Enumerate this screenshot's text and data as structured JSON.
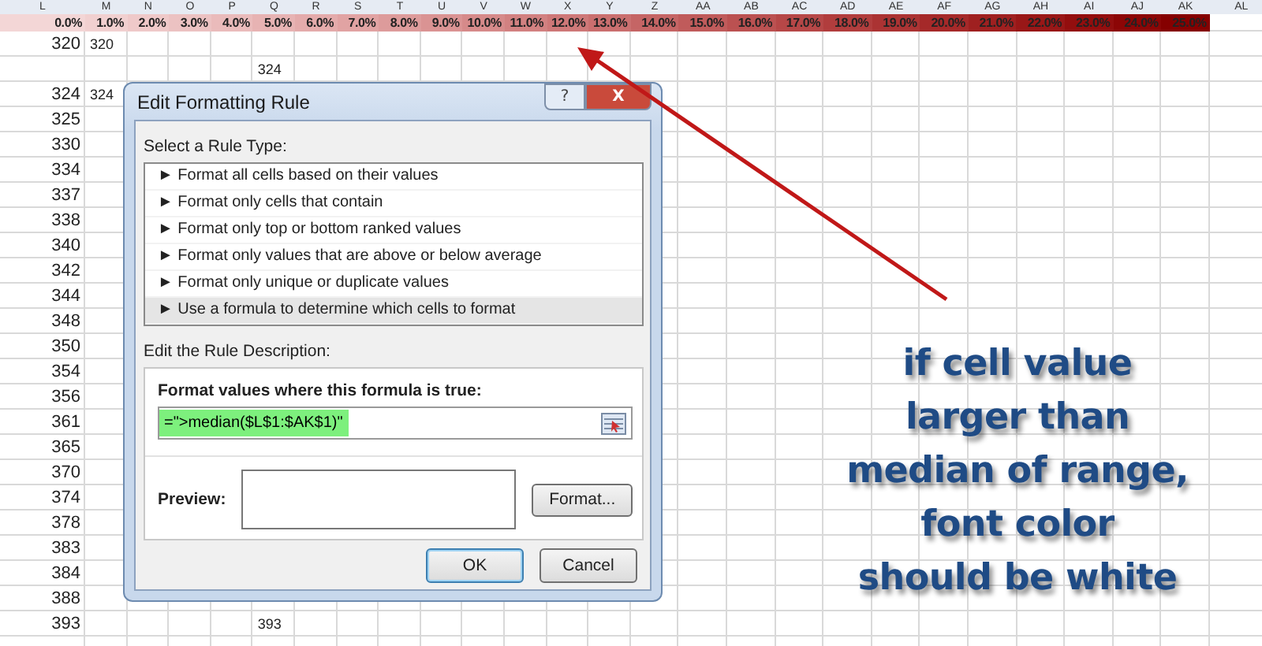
{
  "sheet": {
    "columns": [
      "L",
      "M",
      "N",
      "O",
      "P",
      "Q",
      "R",
      "S",
      "T",
      "U",
      "V",
      "W",
      "X",
      "Y",
      "Z",
      "AA",
      "AB",
      "AC",
      "AD",
      "AE",
      "AF",
      "AG",
      "AH",
      "AI",
      "AJ",
      "AK",
      "AL"
    ],
    "percent_row": [
      {
        "text": "0.0%",
        "color": "#f3d6d6"
      },
      {
        "text": "1.0%",
        "color": "#f1d0d0"
      },
      {
        "text": "2.0%",
        "color": "#efc9c9"
      },
      {
        "text": "3.0%",
        "color": "#ecc2c2"
      },
      {
        "text": "4.0%",
        "color": "#eabbbb"
      },
      {
        "text": "5.0%",
        "color": "#e7b3b3"
      },
      {
        "text": "6.0%",
        "color": "#e4abab"
      },
      {
        "text": "7.0%",
        "color": "#e1a3a3"
      },
      {
        "text": "8.0%",
        "color": "#dd9b9b"
      },
      {
        "text": "9.0%",
        "color": "#da9393"
      },
      {
        "text": "10.0%",
        "color": "#d68a8a"
      },
      {
        "text": "11.0%",
        "color": "#d28181"
      },
      {
        "text": "12.0%",
        "color": "#ce7878"
      },
      {
        "text": "13.0%",
        "color": "#ca6f6f"
      },
      {
        "text": "14.0%",
        "color": "#c56565"
      },
      {
        "text": "15.0%",
        "color": "#c05b5b"
      },
      {
        "text": "16.0%",
        "color": "#bb5151"
      },
      {
        "text": "17.0%",
        "color": "#b64747"
      },
      {
        "text": "18.0%",
        "color": "#b13d3d"
      },
      {
        "text": "19.0%",
        "color": "#ab3333"
      },
      {
        "text": "20.0%",
        "color": "#a52929"
      },
      {
        "text": "21.0%",
        "color": "#9f2020"
      },
      {
        "text": "22.0%",
        "color": "#991717"
      },
      {
        "text": "23.0%",
        "color": "#930e0e"
      },
      {
        "text": "24.0%",
        "color": "#8c0606"
      },
      {
        "text": "25.0%",
        "color": "#850000"
      }
    ],
    "rows": [
      {
        "column_l": "320",
        "column_m": "320"
      },
      {
        "column_q": "324"
      },
      {
        "column_l": "324",
        "column_m": "324"
      },
      {
        "column_l": "325"
      },
      {
        "column_l": "330"
      },
      {
        "column_l": "334"
      },
      {
        "column_l": "337"
      },
      {
        "column_l": "338"
      },
      {
        "column_l": "340"
      },
      {
        "column_l": "342"
      },
      {
        "column_l": "344"
      },
      {
        "column_l": "348"
      },
      {
        "column_l": "350"
      },
      {
        "column_l": "354"
      },
      {
        "column_l": "356"
      },
      {
        "column_l": "361"
      },
      {
        "column_l": "365"
      },
      {
        "column_l": "370"
      },
      {
        "column_l": "374"
      },
      {
        "column_l": "378"
      },
      {
        "column_l": "383"
      },
      {
        "column_l": "384"
      },
      {
        "column_l": "388"
      },
      {
        "column_l": "393",
        "column_q": "393"
      }
    ]
  },
  "dialog": {
    "title": "Edit Formatting Rule",
    "title_buttons": [
      {
        "kind": "help",
        "text": "?"
      },
      {
        "kind": "close",
        "text": "X"
      }
    ],
    "rule_type_label": "Select a Rule Type:",
    "rule_types": [
      {
        "text": "► Format all cells based on their values",
        "selected": false
      },
      {
        "text": "► Format only cells that contain",
        "selected": false
      },
      {
        "text": "► Format only top or bottom ranked values",
        "selected": false
      },
      {
        "text": "► Format only values that are above or below average",
        "selected": false
      },
      {
        "text": "► Format only unique or duplicate values",
        "selected": false
      },
      {
        "text": "► Use a formula to determine which cells to format",
        "selected": true
      }
    ],
    "description_label": "Edit the Rule Description:",
    "formula_label": "Format values where this formula is true:",
    "formula": {
      "value": "=\">median($L$1:$AK$1)\""
    },
    "preview_label": "Preview:",
    "format_button": "Format...",
    "buttons": [
      "OK",
      "Cancel"
    ]
  },
  "annotation": {
    "text": "if cell value\nlarger than\nmedian of range,\nfont color\nshould be white"
  }
}
